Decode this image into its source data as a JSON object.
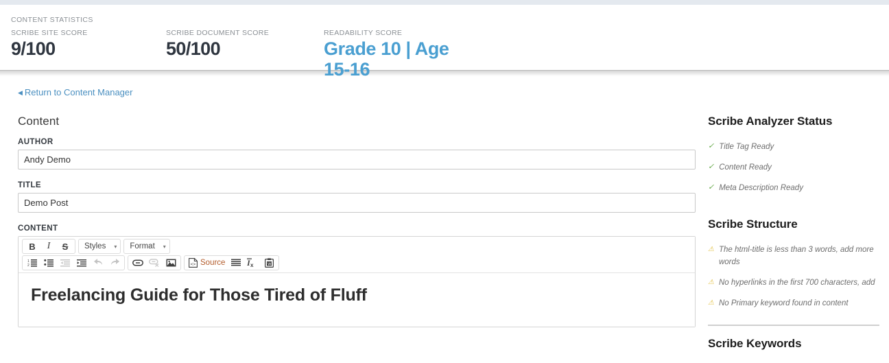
{
  "stats": {
    "heading": "CONTENT STATISTICS",
    "items": [
      {
        "label": "SCRIBE SITE SCORE",
        "value": "9/100"
      },
      {
        "label": "SCRIBE DOCUMENT SCORE",
        "value": "50/100"
      },
      {
        "label": "READABILITY SCORE",
        "value": "Grade 10 | Age 15-16"
      }
    ],
    "accent_color": "#4a9fd1"
  },
  "nav": {
    "return_link": "Return to Content Manager",
    "return_arrow": "◀",
    "link_color": "#4a8fc0"
  },
  "content": {
    "section_title": "Content",
    "author": {
      "label": "AUTHOR",
      "value": "Andy Demo",
      "placeholder": ""
    },
    "title": {
      "label": "TITLE",
      "value": "Demo Post",
      "placeholder": ""
    },
    "body": {
      "label": "CONTENT",
      "heading": "Freelancing Guide for Those Tired of Fluff"
    }
  },
  "toolbar": {
    "row1": {
      "bold": "B",
      "italic": "I",
      "strike": "S",
      "styles": "Styles",
      "format": "Format",
      "arrow": "▾"
    },
    "row2": {
      "source": "Source"
    }
  },
  "sidebar": {
    "analyzer": {
      "heading": "Scribe Analyzer Status",
      "items": [
        "Title Tag Ready",
        "Content Ready",
        "Meta Description Ready"
      ]
    },
    "structure": {
      "heading": "Scribe Structure",
      "items": [
        "The html-title is less than 3 words, add more words",
        "No hyperlinks in the first 700 characters, add",
        "No Primary keyword found in content"
      ]
    },
    "keywords": {
      "heading": "Scribe Keywords"
    },
    "check_glyph": "✓",
    "warn_glyph": "⚠",
    "check_color": "#62a744",
    "warn_color": "#e2bf3f"
  }
}
